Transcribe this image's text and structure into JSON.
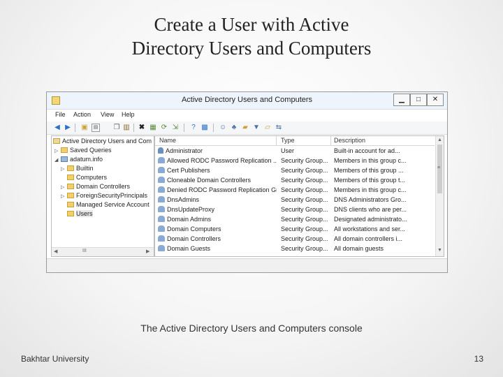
{
  "slide": {
    "title_line1": "Create a User with Active",
    "title_line2": "Directory Users and Computers",
    "caption": "The Active Directory Users and Computers console",
    "footer_left": "Bakhtar University",
    "page_number": "13"
  },
  "window": {
    "title": "Active Directory Users and Computers",
    "minimize": "▁",
    "maximize": "□",
    "close": "✕"
  },
  "menu": [
    "File",
    "Action",
    "View",
    "Help"
  ],
  "toolbar_icons": [
    "back-arrow-icon",
    "forward-arrow-icon",
    "folder-up-icon",
    "console-tree-icon",
    "copy-icon",
    "clipboard-icon",
    "delete-icon",
    "properties-icon",
    "refresh-icon",
    "export-icon",
    "help-icon",
    "mmc-icon",
    "add-user-icon",
    "add-group-icon",
    "add-ou-icon",
    "filter-icon",
    "find-icon",
    "move-icon"
  ],
  "tree": {
    "items": [
      {
        "label": "Active Directory Users and Com",
        "expander": "",
        "icon": "aduc-icon",
        "selected": false
      },
      {
        "label": "Saved Queries",
        "expander": "▷",
        "icon": "folder-icon",
        "selected": false
      },
      {
        "label": "adatum.info",
        "expander": "◢",
        "icon": "domain-icon",
        "selected": false
      },
      {
        "label": "Builtin",
        "expander": "▷",
        "icon": "folder-icon",
        "selected": false
      },
      {
        "label": "Computers",
        "expander": "",
        "icon": "folder-icon",
        "selected": false
      },
      {
        "label": "Domain Controllers",
        "expander": "▷",
        "icon": "folder-icon",
        "selected": false
      },
      {
        "label": "ForeignSecurityPrincipals",
        "expander": "▷",
        "icon": "folder-icon",
        "selected": false
      },
      {
        "label": "Managed Service Account",
        "expander": "",
        "icon": "folder-icon",
        "selected": false
      },
      {
        "label": "Users",
        "expander": "",
        "icon": "folder-icon",
        "selected": true
      }
    ],
    "scroll_left": "◀",
    "scroll_mid": "III",
    "scroll_right": "▶"
  },
  "list": {
    "columns": [
      "Name",
      "Type",
      "Description"
    ],
    "rows": [
      {
        "name": "Administrator",
        "type": "User",
        "description": "Built-in account for ad...",
        "icon": "user-icon"
      },
      {
        "name": "Allowed RODC Password Replication ...",
        "type": "Security Group...",
        "description": "Members in this group c...",
        "icon": "group-icon"
      },
      {
        "name": "Cert Publishers",
        "type": "Security Group...",
        "description": "Members of this group ...",
        "icon": "group-icon"
      },
      {
        "name": "Cloneable Domain Controllers",
        "type": "Security Group...",
        "description": "Members of this group t...",
        "icon": "group-icon"
      },
      {
        "name": "Denied RODC Password Replication Gr...",
        "type": "Security Group...",
        "description": "Members in this group c...",
        "icon": "group-icon"
      },
      {
        "name": "DnsAdmins",
        "type": "Security Group...",
        "description": "DNS Administrators Gro...",
        "icon": "group-icon"
      },
      {
        "name": "DnsUpdateProxy",
        "type": "Security Group...",
        "description": "DNS clients who are per...",
        "icon": "group-icon"
      },
      {
        "name": "Domain Admins",
        "type": "Security Group...",
        "description": "Designated administrato...",
        "icon": "group-icon"
      },
      {
        "name": "Domain Computers",
        "type": "Security Group...",
        "description": "All workstations and ser...",
        "icon": "group-icon"
      },
      {
        "name": "Domain Controllers",
        "type": "Security Group...",
        "description": "All domain controllers i...",
        "icon": "group-icon"
      },
      {
        "name": "Domain Guests",
        "type": "Security Group...",
        "description": "All domain guests",
        "icon": "group-icon"
      }
    ],
    "scroll_up": "▲",
    "scroll_grip": "≡",
    "scroll_down": "▼"
  }
}
